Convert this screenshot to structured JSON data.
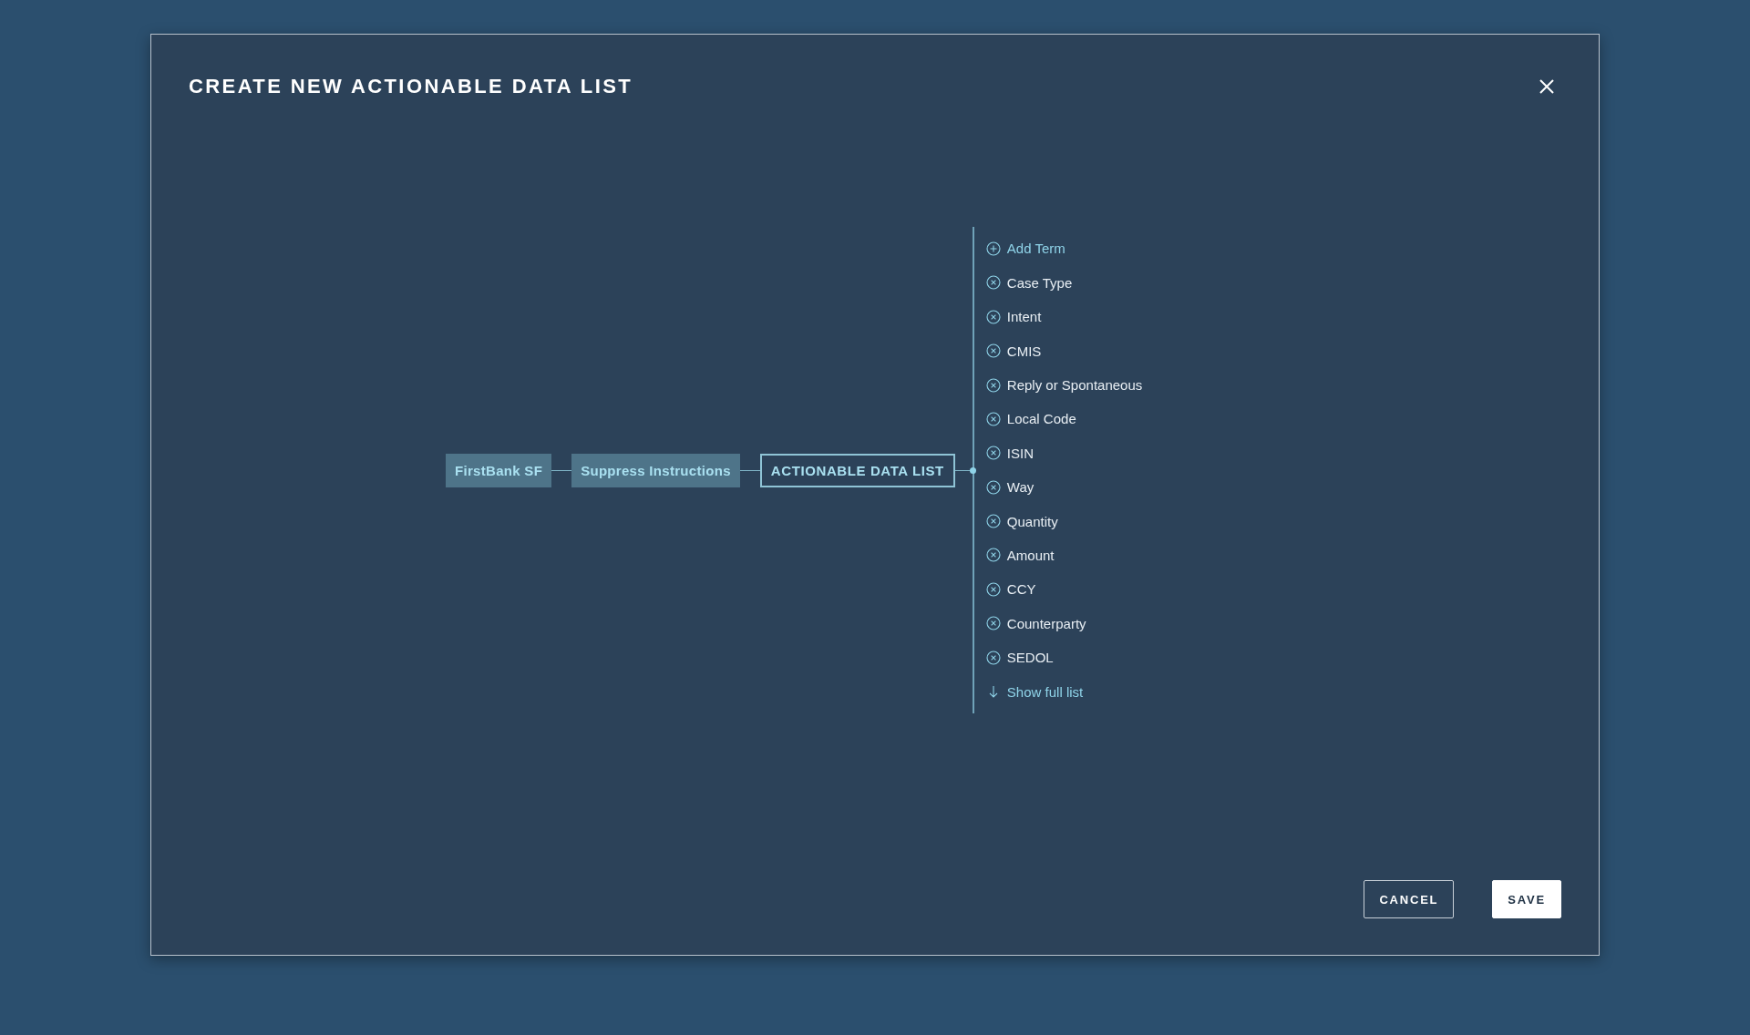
{
  "dialog": {
    "title": "CREATE NEW ACTIONABLE DATA LIST"
  },
  "path": [
    {
      "label": "FirstBank SF",
      "kind": "filled"
    },
    {
      "label": "Suppress Instructions",
      "kind": "filled"
    },
    {
      "label": "ACTIONABLE DATA LIST",
      "kind": "outlined"
    }
  ],
  "terms": [
    {
      "label": "Add Term",
      "kind": "add"
    },
    {
      "label": "Case Type",
      "kind": "term"
    },
    {
      "label": "Intent",
      "kind": "term"
    },
    {
      "label": "CMIS",
      "kind": "term"
    },
    {
      "label": "Reply or Spontaneous",
      "kind": "term"
    },
    {
      "label": "Local Code",
      "kind": "term"
    },
    {
      "label": "ISIN",
      "kind": "term"
    },
    {
      "label": "Way",
      "kind": "term"
    },
    {
      "label": "Quantity",
      "kind": "term"
    },
    {
      "label": "Amount",
      "kind": "term"
    },
    {
      "label": "CCY",
      "kind": "term"
    },
    {
      "label": "Counterparty",
      "kind": "term"
    },
    {
      "label": "SEDOL",
      "kind": "term"
    },
    {
      "label": "Show full list",
      "kind": "more"
    }
  ],
  "buttons": [
    {
      "label": "CANCEL",
      "kind": "secondary"
    },
    {
      "label": "SAVE",
      "kind": "primary"
    }
  ]
}
